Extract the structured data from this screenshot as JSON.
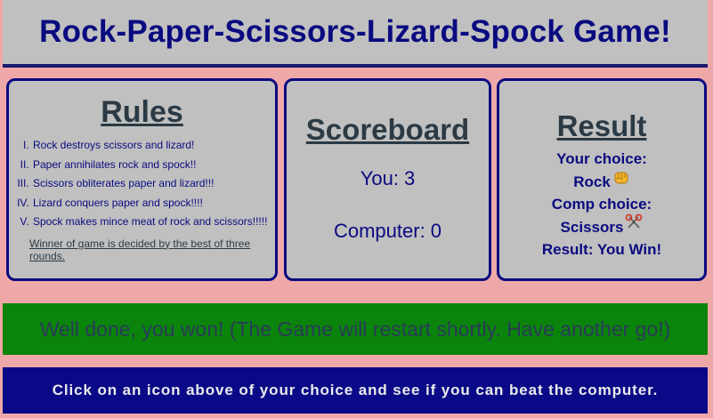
{
  "header": {
    "title": "Rock-Paper-Scissors-Lizard-Spock Game!"
  },
  "rules": {
    "title": "Rules",
    "items": [
      "Rock destroys scissors and lizard!",
      "Paper annihilates rock and spock!!",
      "Scissors obliterates paper and lizard!!!",
      "Lizard conquers paper and spock!!!!",
      "Spock makes mince meat of rock and scissors!!!!!"
    ],
    "winner_note": "Winner of game is decided by the best of three rounds."
  },
  "scoreboard": {
    "title": "Scoreboard",
    "you": "You: 3",
    "computer": "Computer: 0"
  },
  "result": {
    "title": "Result",
    "your_choice_label": "Your choice:",
    "your_choice_value": "Rock",
    "your_choice_icon": "fist-icon",
    "comp_choice_label": "Comp choice:",
    "comp_choice_value": "Scissors",
    "comp_choice_icon": "scissors-icon",
    "outcome": "Result: You Win!"
  },
  "banner": {
    "message": "Well done, you won! (The Game will restart shortly. Have another go!)"
  },
  "instructions": {
    "text": "Click on an icon above of your choice and see if you can beat the computer."
  },
  "colors": {
    "background": "#efa8a8",
    "panel": "#c0c0c0",
    "navy": "#0a0a80",
    "banner_green": "#0a840a",
    "instructions_blue": "#0a0a88"
  }
}
